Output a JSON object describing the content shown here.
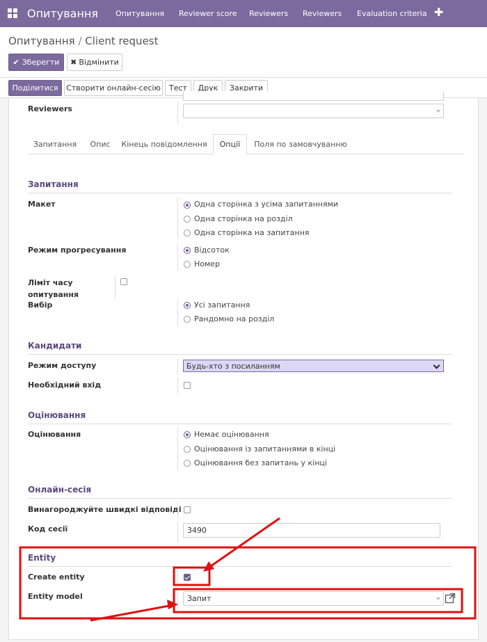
{
  "nav": {
    "app_title": "Опитування",
    "menu": [
      "Опитування",
      "Reviewer score",
      "Reviewers",
      "Reviewers",
      "Evaluation criteria"
    ],
    "plus_icon": "plus-icon",
    "apps_icon": "apps-grid-icon"
  },
  "breadcrumb": {
    "parent": "Опитування",
    "separator": "/",
    "current": "Client request"
  },
  "actions": {
    "save": "Зберегти",
    "discard": "Відмінити"
  },
  "toolbar": {
    "share": "Поділитися",
    "create_session": "Створити онлайн-сесію",
    "test": "Тест",
    "print": "Друк",
    "close": "Закрити"
  },
  "reviewers_label": "Reviewers",
  "reviewers_value": "",
  "tabs": [
    "Запитання",
    "Опис",
    "Кінець повідомлення",
    "Опції",
    "Поля по замовчуванню"
  ],
  "active_tab": "Опції",
  "sections": {
    "questions": {
      "title": "Запитання",
      "layout_label": "Макет",
      "layout_options": [
        "Одна сторінка з усіма запитаннями",
        "Одна сторінка на розділ",
        "Одна сторінка на запитання"
      ],
      "layout_selected": 0,
      "progress_label": "Режим прогресування",
      "progress_options": [
        "Відсоток",
        "Номер"
      ],
      "progress_selected": 0,
      "time_limit_label": "Ліміт часу опитування",
      "time_limit_checked": false,
      "selection_label": "Вибір",
      "selection_options": [
        "Усі запитання",
        "Рандомно на розділ"
      ],
      "selection_selected": 0
    },
    "candidates": {
      "title": "Кандидати",
      "access_label": "Режим доступу",
      "access_value": "Будь-хто з посиланням",
      "login_label": "Необхідний вхід",
      "login_checked": false
    },
    "scoring": {
      "title": "Оцінювання",
      "scoring_label": "Оцінювання",
      "options": [
        "Немає оцінювання",
        "Оцінювання із запитаннями в кінці",
        "Оцінювання без запитань у кінці"
      ],
      "selected": 0
    },
    "session": {
      "title": "Онлайн-сесія",
      "reward_label": "Винагороджуйте швидкі відповіді",
      "reward_checked": false,
      "code_label": "Код сесії",
      "code_value": "3490"
    },
    "entity": {
      "title": "Entity",
      "create_label": "Create entity",
      "create_checked": true,
      "model_label": "Entity model",
      "model_value": "Запит"
    }
  },
  "colors": {
    "brand": "#7c6a9e",
    "annotation": "#e01010",
    "select_highlight": "#dcd7f5"
  }
}
